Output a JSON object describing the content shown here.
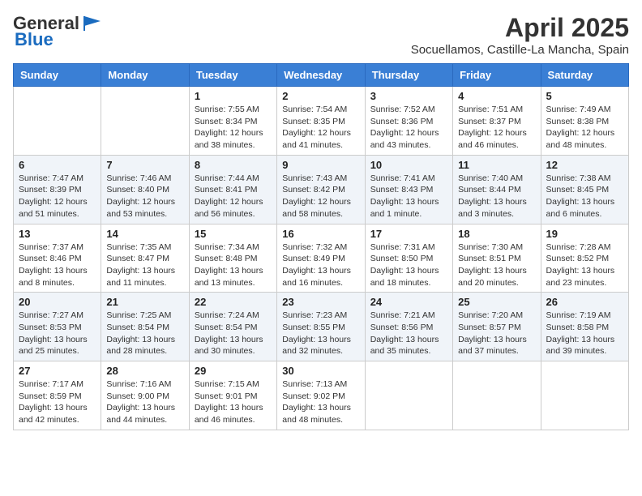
{
  "header": {
    "logo_line1": "General",
    "logo_line2": "Blue",
    "title": "April 2025",
    "subtitle": "Socuellamos, Castille-La Mancha, Spain"
  },
  "weekdays": [
    "Sunday",
    "Monday",
    "Tuesday",
    "Wednesday",
    "Thursday",
    "Friday",
    "Saturday"
  ],
  "weeks": [
    [
      {
        "day": "",
        "info": ""
      },
      {
        "day": "",
        "info": ""
      },
      {
        "day": "1",
        "info": "Sunrise: 7:55 AM\nSunset: 8:34 PM\nDaylight: 12 hours and 38 minutes."
      },
      {
        "day": "2",
        "info": "Sunrise: 7:54 AM\nSunset: 8:35 PM\nDaylight: 12 hours and 41 minutes."
      },
      {
        "day": "3",
        "info": "Sunrise: 7:52 AM\nSunset: 8:36 PM\nDaylight: 12 hours and 43 minutes."
      },
      {
        "day": "4",
        "info": "Sunrise: 7:51 AM\nSunset: 8:37 PM\nDaylight: 12 hours and 46 minutes."
      },
      {
        "day": "5",
        "info": "Sunrise: 7:49 AM\nSunset: 8:38 PM\nDaylight: 12 hours and 48 minutes."
      }
    ],
    [
      {
        "day": "6",
        "info": "Sunrise: 7:47 AM\nSunset: 8:39 PM\nDaylight: 12 hours and 51 minutes."
      },
      {
        "day": "7",
        "info": "Sunrise: 7:46 AM\nSunset: 8:40 PM\nDaylight: 12 hours and 53 minutes."
      },
      {
        "day": "8",
        "info": "Sunrise: 7:44 AM\nSunset: 8:41 PM\nDaylight: 12 hours and 56 minutes."
      },
      {
        "day": "9",
        "info": "Sunrise: 7:43 AM\nSunset: 8:42 PM\nDaylight: 12 hours and 58 minutes."
      },
      {
        "day": "10",
        "info": "Sunrise: 7:41 AM\nSunset: 8:43 PM\nDaylight: 13 hours and 1 minute."
      },
      {
        "day": "11",
        "info": "Sunrise: 7:40 AM\nSunset: 8:44 PM\nDaylight: 13 hours and 3 minutes."
      },
      {
        "day": "12",
        "info": "Sunrise: 7:38 AM\nSunset: 8:45 PM\nDaylight: 13 hours and 6 minutes."
      }
    ],
    [
      {
        "day": "13",
        "info": "Sunrise: 7:37 AM\nSunset: 8:46 PM\nDaylight: 13 hours and 8 minutes."
      },
      {
        "day": "14",
        "info": "Sunrise: 7:35 AM\nSunset: 8:47 PM\nDaylight: 13 hours and 11 minutes."
      },
      {
        "day": "15",
        "info": "Sunrise: 7:34 AM\nSunset: 8:48 PM\nDaylight: 13 hours and 13 minutes."
      },
      {
        "day": "16",
        "info": "Sunrise: 7:32 AM\nSunset: 8:49 PM\nDaylight: 13 hours and 16 minutes."
      },
      {
        "day": "17",
        "info": "Sunrise: 7:31 AM\nSunset: 8:50 PM\nDaylight: 13 hours and 18 minutes."
      },
      {
        "day": "18",
        "info": "Sunrise: 7:30 AM\nSunset: 8:51 PM\nDaylight: 13 hours and 20 minutes."
      },
      {
        "day": "19",
        "info": "Sunrise: 7:28 AM\nSunset: 8:52 PM\nDaylight: 13 hours and 23 minutes."
      }
    ],
    [
      {
        "day": "20",
        "info": "Sunrise: 7:27 AM\nSunset: 8:53 PM\nDaylight: 13 hours and 25 minutes."
      },
      {
        "day": "21",
        "info": "Sunrise: 7:25 AM\nSunset: 8:54 PM\nDaylight: 13 hours and 28 minutes."
      },
      {
        "day": "22",
        "info": "Sunrise: 7:24 AM\nSunset: 8:54 PM\nDaylight: 13 hours and 30 minutes."
      },
      {
        "day": "23",
        "info": "Sunrise: 7:23 AM\nSunset: 8:55 PM\nDaylight: 13 hours and 32 minutes."
      },
      {
        "day": "24",
        "info": "Sunrise: 7:21 AM\nSunset: 8:56 PM\nDaylight: 13 hours and 35 minutes."
      },
      {
        "day": "25",
        "info": "Sunrise: 7:20 AM\nSunset: 8:57 PM\nDaylight: 13 hours and 37 minutes."
      },
      {
        "day": "26",
        "info": "Sunrise: 7:19 AM\nSunset: 8:58 PM\nDaylight: 13 hours and 39 minutes."
      }
    ],
    [
      {
        "day": "27",
        "info": "Sunrise: 7:17 AM\nSunset: 8:59 PM\nDaylight: 13 hours and 42 minutes."
      },
      {
        "day": "28",
        "info": "Sunrise: 7:16 AM\nSunset: 9:00 PM\nDaylight: 13 hours and 44 minutes."
      },
      {
        "day": "29",
        "info": "Sunrise: 7:15 AM\nSunset: 9:01 PM\nDaylight: 13 hours and 46 minutes."
      },
      {
        "day": "30",
        "info": "Sunrise: 7:13 AM\nSunset: 9:02 PM\nDaylight: 13 hours and 48 minutes."
      },
      {
        "day": "",
        "info": ""
      },
      {
        "day": "",
        "info": ""
      },
      {
        "day": "",
        "info": ""
      }
    ]
  ]
}
